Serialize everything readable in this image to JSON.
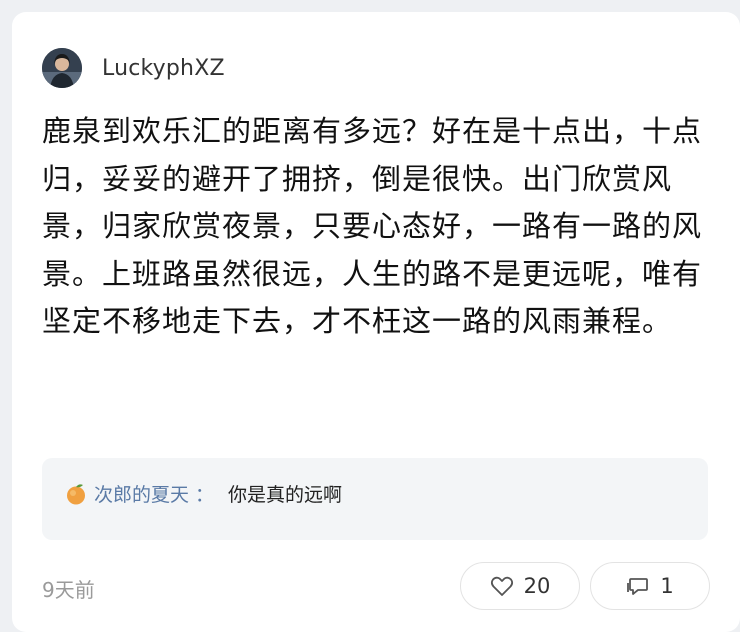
{
  "post": {
    "author": "LuckyphXZ",
    "text": "鹿泉到欢乐汇的距离有多远？好在是十点出，十点归，妥妥的避开了拥挤，倒是很快。出门欣赏风景，归家欣赏夜景，只要心态好，一路有一路的风景。上班路虽然很远，人生的路不是更远呢，唯有坚定不移地走下去，才不枉这一路的风雨兼程。",
    "timestamp": "9天前"
  },
  "comment_preview": {
    "author": "次郎的夏天",
    "separator": "：",
    "text": "你是真的远啊",
    "icon": "peach-icon"
  },
  "actions": {
    "likes": "20",
    "comments": "1",
    "like_icon": "heart-icon",
    "comment_icon": "comment-icon"
  },
  "colors": {
    "comment_author": "#5a7aa6",
    "comment_bg": "#f3f5f7",
    "card_bg": "#ffffff",
    "page_bg": "#eef0f3"
  }
}
